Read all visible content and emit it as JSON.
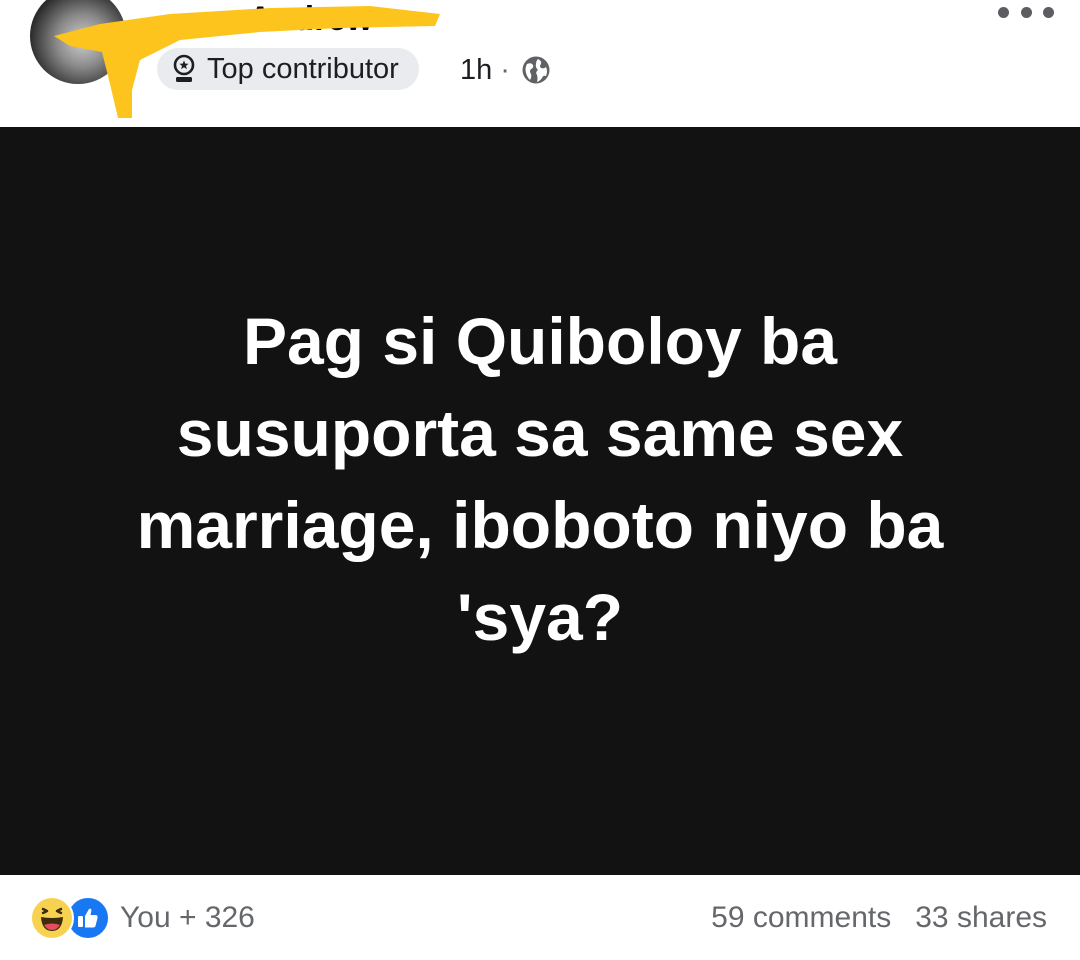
{
  "post": {
    "author": {
      "name": "Andrew",
      "badge_label": "Top contributor",
      "badge_icon": "top-contributor-badge-icon"
    },
    "timestamp": "1h",
    "separator": "·",
    "privacy_icon": "globe-icon",
    "more_icon": "more-options-icon",
    "text": "Pag si Quiboloy ba susuporta sa same sex marriage, iboboto niyo ba 'sya?",
    "card_background": "#121212",
    "card_text_color": "#ffffff"
  },
  "footer": {
    "reaction_icons": [
      "haha-reaction-icon",
      "like-reaction-icon"
    ],
    "reaction_summary": "You + 326",
    "comments": "59 comments",
    "shares": "33 shares"
  },
  "colors": {
    "redaction_highlight": "#fcc41c",
    "badge_background": "#e9ebee",
    "secondary_text": "#65676b",
    "like_blue": "#1877f2",
    "haha_yellow": "#f7d251"
  }
}
